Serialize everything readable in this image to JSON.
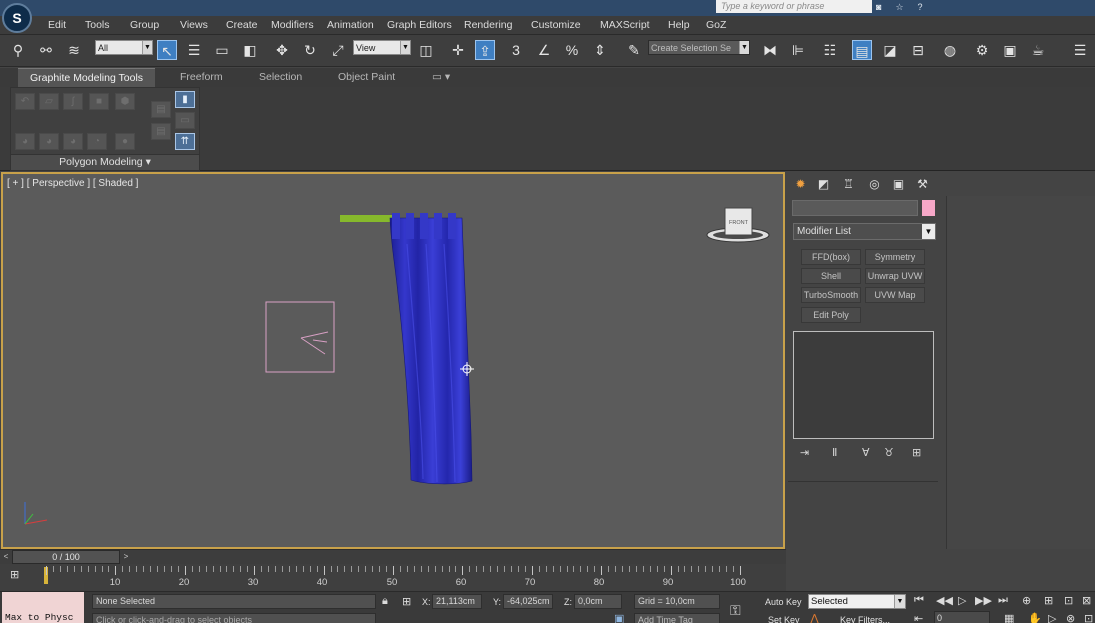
{
  "search": {
    "placeholder": "Type a keyword or phrase"
  },
  "app": {
    "logo": "S"
  },
  "titlebar_icons": [
    "binoculars-icon",
    "star-icon",
    "help-icon"
  ],
  "menu": [
    "Edit",
    "Tools",
    "Group",
    "Views",
    "Create",
    "Modifiers",
    "Animation",
    "Graph Editors",
    "Rendering",
    "Customize",
    "MAXScript",
    "Help",
    "GoZ"
  ],
  "toolbar": {
    "selection_filter": "All",
    "reference_coord": "View",
    "named_selection": "Create Selection Se",
    "snap_3": "3",
    "snap_percent": "%"
  },
  "ribbon": {
    "tabs": [
      "Graphite Modeling Tools",
      "Freeform",
      "Selection",
      "Object Paint"
    ],
    "panel_label": "Polygon Modeling"
  },
  "viewport": {
    "label": "[ + ] [ Perspective ] [ Shaded ]",
    "viewcube_face": "FRONT"
  },
  "command_panel": {
    "modifier_list": "Modifier List",
    "modifiers": [
      "FFD(box)",
      "Symmetry",
      "Shell",
      "Unwrap UVW",
      "TurboSmooth",
      "UVW Map",
      "Edit Poly"
    ],
    "swatch_color": "#f7a8c8"
  },
  "timeline": {
    "position": "0 / 100",
    "ticks": [
      "10",
      "20",
      "30",
      "40",
      "50",
      "60",
      "70",
      "80",
      "90",
      "100"
    ]
  },
  "status": {
    "listener": "Max to Physc",
    "selection": "None Selected",
    "prompt": "Click or click-and-drag to select objects",
    "x_label": "X:",
    "x": "21,113cm",
    "y_label": "Y:",
    "y": "-64,025cm",
    "z_label": "Z:",
    "z": "0,0cm",
    "grid": "Grid = 10,0cm",
    "add_time_tag": "Add Time Tag",
    "auto_key": "Auto Key",
    "auto_key_mode": "Selected",
    "set_key": "Set Key",
    "key_filters": "Key Filters...",
    "frame": "0"
  },
  "colors": {
    "accent_active": "#3f7fc2",
    "viewport_border": "#c8a14a",
    "curtain": "#2d2fbe",
    "rod": "#8ab82e"
  }
}
